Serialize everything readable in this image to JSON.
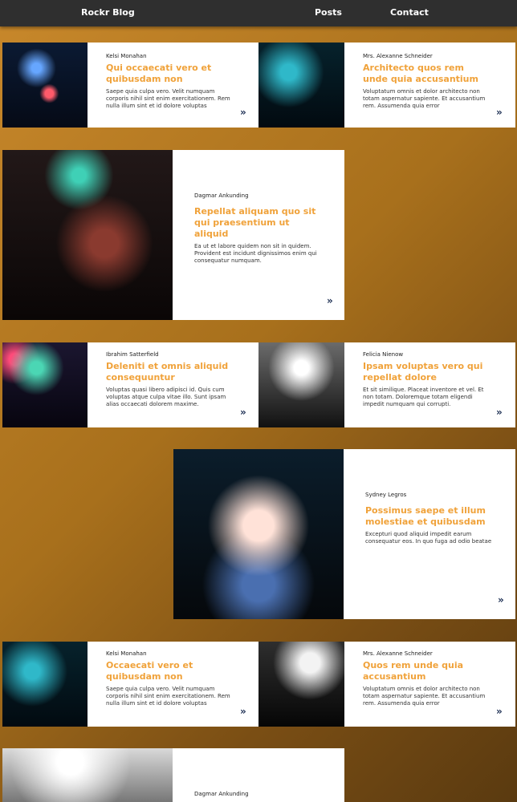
{
  "nav": {
    "brand": "Rockr Blog",
    "posts": "Posts",
    "contact": "Contact"
  },
  "more_glyph": "»",
  "posts": [
    {
      "author": "Kelsi Monahan",
      "title": "Qui occaecati vero et quibusdam non",
      "excerpt": "Saepe quia culpa vero. Velit numquam corporis nihil sint enim exercitationem. Rem nulla illum sint et id dolore voluptas"
    },
    {
      "author": "Mrs. Alexanne Schneider",
      "title": "Architecto quos rem unde quia accusantium",
      "excerpt": "Voluptatum omnis et dolor architecto non totam aspernatur sapiente. Et accusantium rem. Assumenda quia error"
    },
    {
      "author": "Dagmar Ankunding",
      "title": "Repellat aliquam quo sit qui praesentium ut aliquid",
      "excerpt": "Ea ut et labore quidem non sit in quidem. Provident est incidunt dignissimos enim qui consequatur numquam."
    },
    {
      "author": "Ibrahim Satterfield",
      "title": "Deleniti et omnis aliquid consequuntur",
      "excerpt": "Voluptas quasi libero adipisci id. Quis cum voluptas atque culpa vitae illo. Sunt ipsam alias occaecati dolorem maxime."
    },
    {
      "author": "Felicia Nienow",
      "title": "Ipsam voluptas vero qui repellat dolore",
      "excerpt": "Et sit similique. Placeat inventore et vel. Et non totam. Doloremque totam eligendi impedit numquam qui corrupti."
    },
    {
      "author": "Sydney Legros",
      "title": "Possimus saepe et illum molestiae et quibusdam",
      "excerpt": "Excepturi quod aliquid impedit earum consequatur eos. In quo fuga ad odio beatae"
    },
    {
      "author": "Kelsi Monahan",
      "title": "Occaecati vero et quibusdam non",
      "excerpt": "Saepe quia culpa vero. Velit numquam corporis nihil sint enim exercitationem. Rem nulla illum sint et id dolore voluptas"
    },
    {
      "author": "Mrs. Alexanne Schneider",
      "title": "Quos rem unde quia accusantium",
      "excerpt": "Voluptatum omnis et dolor architecto non totam aspernatur sapiente. Et accusantium rem. Assumenda quia error"
    },
    {
      "author": "Dagmar Ankunding",
      "title": "",
      "excerpt": ""
    }
  ]
}
